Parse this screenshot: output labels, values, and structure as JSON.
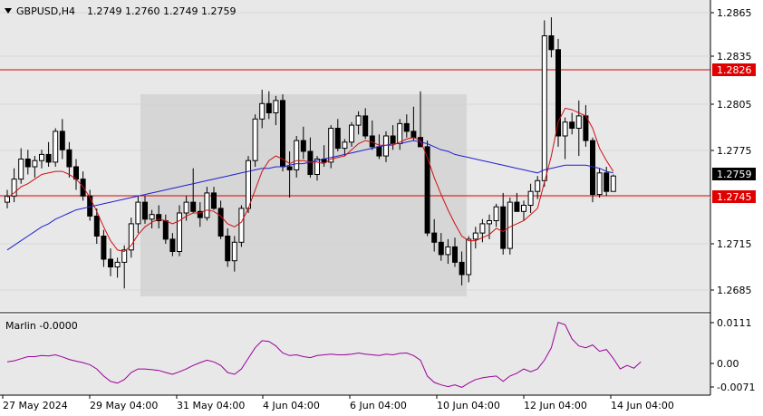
{
  "header": {
    "symbol_label": "GBPUSD,H4",
    "ohlc": "1.2749 1.2760 1.2749 1.2759"
  },
  "indicator": {
    "label": "Marlin -0.0000",
    "ticks": [
      "0.0111",
      "0.00",
      "-0.0071"
    ]
  },
  "price_axis": {
    "ticks": [
      "1.2865",
      "1.2835",
      "1.2805",
      "1.2775",
      "1.2745",
      "1.2715",
      "1.2685"
    ]
  },
  "price_tags": {
    "level_high": "1.2826",
    "current": "1.2759",
    "level_low": "1.2745"
  },
  "time_axis": [
    "27 May 2024",
    "29 May 04:00",
    "31 May 04:00",
    "4 Jun 04:00",
    "6 Jun 04:00",
    "10 Jun 04:00",
    "12 Jun 04:00",
    "14 Jun 04:00"
  ],
  "colors": {
    "background": "#e8e8e8",
    "bull": "#ffffff",
    "bear": "#000000",
    "ma_fast": "#d01010",
    "ma_slow": "#2020d0",
    "level_line": "#e00000",
    "oscillator": "#9a009a",
    "zone": "#d0d0d0"
  },
  "chart_data": {
    "type": "candlestick",
    "symbol": "GBPUSD",
    "timeframe": "H4",
    "ylim": [
      1.267,
      1.2875
    ],
    "levels": [
      1.2826,
      1.2745
    ],
    "current_price": 1.2759,
    "indicator_ylim": [
      -0.0085,
      0.0125
    ],
    "candles": [
      [
        1.2742,
        1.275,
        1.2738,
        1.2746
      ],
      [
        1.2746,
        1.2764,
        1.2742,
        1.2757
      ],
      [
        1.2757,
        1.2777,
        1.2754,
        1.277
      ],
      [
        1.277,
        1.2776,
        1.276,
        1.2765
      ],
      [
        1.2765,
        1.2772,
        1.2758,
        1.2769
      ],
      [
        1.2769,
        1.2776,
        1.2764,
        1.2773
      ],
      [
        1.2773,
        1.2781,
        1.2765,
        1.2768
      ],
      [
        1.2768,
        1.279,
        1.2765,
        1.2788
      ],
      [
        1.2788,
        1.2796,
        1.277,
        1.2776
      ],
      [
        1.2776,
        1.2781,
        1.2758,
        1.2765
      ],
      [
        1.2765,
        1.277,
        1.275,
        1.2757
      ],
      [
        1.2757,
        1.2762,
        1.2743,
        1.2746
      ],
      [
        1.2746,
        1.275,
        1.273,
        1.2733
      ],
      [
        1.2733,
        1.2738,
        1.2715,
        1.272
      ],
      [
        1.272,
        1.2724,
        1.27,
        1.2705
      ],
      [
        1.2705,
        1.2712,
        1.2694,
        1.27
      ],
      [
        1.27,
        1.2706,
        1.2693,
        1.2703
      ],
      [
        1.2703,
        1.2714,
        1.2686,
        1.2711
      ],
      [
        1.2711,
        1.2732,
        1.2706,
        1.2728
      ],
      [
        1.2728,
        1.2746,
        1.2722,
        1.2742
      ],
      [
        1.2742,
        1.2746,
        1.2728,
        1.2731
      ],
      [
        1.2731,
        1.2737,
        1.2725,
        1.2734
      ],
      [
        1.2734,
        1.274,
        1.2725,
        1.273
      ],
      [
        1.273,
        1.2734,
        1.2715,
        1.2718
      ],
      [
        1.2718,
        1.2722,
        1.2707,
        1.271
      ],
      [
        1.271,
        1.274,
        1.2707,
        1.2735
      ],
      [
        1.2735,
        1.2746,
        1.273,
        1.2742
      ],
      [
        1.2742,
        1.2764,
        1.2735,
        1.2736
      ],
      [
        1.2736,
        1.2742,
        1.2726,
        1.2732
      ],
      [
        1.2732,
        1.2752,
        1.273,
        1.2748
      ],
      [
        1.2748,
        1.2752,
        1.2737,
        1.2738
      ],
      [
        1.2738,
        1.2743,
        1.2718,
        1.272
      ],
      [
        1.272,
        1.2725,
        1.27,
        1.2704
      ],
      [
        1.2704,
        1.272,
        1.2697,
        1.2716
      ],
      [
        1.2716,
        1.274,
        1.2713,
        1.2738
      ],
      [
        1.2738,
        1.2772,
        1.2735,
        1.2769
      ],
      [
        1.2769,
        1.2799,
        1.2765,
        1.2796
      ],
      [
        1.2796,
        1.2815,
        1.279,
        1.2806
      ],
      [
        1.2806,
        1.2814,
        1.2796,
        1.28
      ],
      [
        1.28,
        1.2811,
        1.2792,
        1.2808
      ],
      [
        1.2808,
        1.2812,
        1.2762,
        1.2765
      ],
      [
        1.2765,
        1.2775,
        1.2745,
        1.2763
      ],
      [
        1.2763,
        1.2785,
        1.2758,
        1.2782
      ],
      [
        1.2782,
        1.2791,
        1.277,
        1.2775
      ],
      [
        1.2775,
        1.2784,
        1.2758,
        1.276
      ],
      [
        1.276,
        1.2772,
        1.2756,
        1.277
      ],
      [
        1.277,
        1.2779,
        1.2765,
        1.2768
      ],
      [
        1.2768,
        1.2792,
        1.2764,
        1.279
      ],
      [
        1.279,
        1.2796,
        1.2775,
        1.2777
      ],
      [
        1.2777,
        1.2783,
        1.2772,
        1.2781
      ],
      [
        1.2781,
        1.2794,
        1.2778,
        1.2792
      ],
      [
        1.2792,
        1.2801,
        1.2786,
        1.2798
      ],
      [
        1.2798,
        1.2803,
        1.2783,
        1.2785
      ],
      [
        1.2785,
        1.2795,
        1.2776,
        1.2778
      ],
      [
        1.2778,
        1.2786,
        1.277,
        1.2772
      ],
      [
        1.2772,
        1.2788,
        1.2768,
        1.2785
      ],
      [
        1.2785,
        1.2792,
        1.2776,
        1.278
      ],
      [
        1.278,
        1.2796,
        1.2776,
        1.2793
      ],
      [
        1.2793,
        1.2799,
        1.2784,
        1.2788
      ],
      [
        1.2788,
        1.2804,
        1.2782,
        1.2784
      ],
      [
        1.2784,
        1.2814,
        1.2778,
        1.2778
      ],
      [
        1.2778,
        1.2782,
        1.272,
        1.2722
      ],
      [
        1.2722,
        1.2731,
        1.271,
        1.2716
      ],
      [
        1.2716,
        1.2722,
        1.2704,
        1.2708
      ],
      [
        1.2708,
        1.2718,
        1.2702,
        1.2713
      ],
      [
        1.2713,
        1.2719,
        1.27,
        1.2703
      ],
      [
        1.2703,
        1.271,
        1.2688,
        1.2695
      ],
      [
        1.2695,
        1.272,
        1.269,
        1.2718
      ],
      [
        1.2718,
        1.2726,
        1.2712,
        1.2722
      ],
      [
        1.2722,
        1.2731,
        1.2716,
        1.2728
      ],
      [
        1.2728,
        1.2734,
        1.2718,
        1.273
      ],
      [
        1.273,
        1.2741,
        1.2726,
        1.2739
      ],
      [
        1.2739,
        1.2748,
        1.2708,
        1.2712
      ],
      [
        1.2712,
        1.2745,
        1.2708,
        1.2742
      ],
      [
        1.2742,
        1.2748,
        1.2736,
        1.2736
      ],
      [
        1.2736,
        1.2743,
        1.273,
        1.274
      ],
      [
        1.274,
        1.2754,
        1.2735,
        1.2749
      ],
      [
        1.2749,
        1.2759,
        1.2744,
        1.2756
      ],
      [
        1.2756,
        1.286,
        1.2752,
        1.285
      ],
      [
        1.285,
        1.2862,
        1.2836,
        1.2841
      ],
      [
        1.2841,
        1.2848,
        1.2778,
        1.2785
      ],
      [
        1.2785,
        1.2797,
        1.277,
        1.2794
      ],
      [
        1.2794,
        1.28,
        1.2786,
        1.279
      ],
      [
        1.279,
        1.2808,
        1.2772,
        1.2798
      ],
      [
        1.2798,
        1.2805,
        1.2778,
        1.2782
      ],
      [
        1.2782,
        1.2784,
        1.2742,
        1.2747
      ],
      [
        1.2747,
        1.2764,
        1.2745,
        1.2761
      ],
      [
        1.2761,
        1.2765,
        1.2746,
        1.2749
      ],
      [
        1.2749,
        1.276,
        1.2749,
        1.2759
      ]
    ],
    "ma_fast": [
      1.2745,
      1.2748,
      1.2752,
      1.2754,
      1.2757,
      1.276,
      1.2761,
      1.2762,
      1.2762,
      1.276,
      1.2757,
      1.2752,
      1.2745,
      1.2736,
      1.2726,
      1.2717,
      1.2711,
      1.271,
      1.2714,
      1.2721,
      1.2726,
      1.2729,
      1.2731,
      1.273,
      1.2728,
      1.273,
      1.2733,
      1.2735,
      1.2735,
      1.2737,
      1.2736,
      1.2733,
      1.2728,
      1.2726,
      1.2729,
      1.2738,
      1.275,
      1.2762,
      1.2769,
      1.2772,
      1.277,
      1.2767,
      1.2769,
      1.2769,
      1.2768,
      1.2768,
      1.2767,
      1.277,
      1.2771,
      1.2772,
      1.2776,
      1.278,
      1.2782,
      1.2781,
      1.2779,
      1.2779,
      1.2779,
      1.2781,
      1.2783,
      1.2784,
      1.2782,
      1.2771,
      1.2758,
      1.2747,
      1.2737,
      1.2728,
      1.272,
      1.2717,
      1.2717,
      1.2719,
      1.2721,
      1.2725,
      1.2723,
      1.2726,
      1.2728,
      1.273,
      1.2734,
      1.2738,
      1.2755,
      1.2772,
      1.2794,
      1.2803,
      1.2802,
      1.28,
      1.2798,
      1.279,
      1.2777,
      1.2769,
      1.2762
    ],
    "ma_slow": [
      1.2711,
      1.2714,
      1.2717,
      1.272,
      1.2723,
      1.2726,
      1.2728,
      1.2731,
      1.2733,
      1.2735,
      1.2737,
      1.2738,
      1.2739,
      1.274,
      1.2741,
      1.2742,
      1.2743,
      1.2744,
      1.2745,
      1.2746,
      1.2747,
      1.2748,
      1.2749,
      1.275,
      1.2751,
      1.2752,
      1.2753,
      1.2754,
      1.2755,
      1.2756,
      1.2757,
      1.2758,
      1.2759,
      1.276,
      1.2761,
      1.2762,
      1.2763,
      1.2764,
      1.2764,
      1.2765,
      1.2765,
      1.2766,
      1.2767,
      1.2767,
      1.2768,
      1.2769,
      1.277,
      1.2771,
      1.2772,
      1.2773,
      1.2774,
      1.2775,
      1.2776,
      1.2777,
      1.2778,
      1.2779,
      1.278,
      1.278,
      1.2781,
      1.2782,
      1.2781,
      1.278,
      1.2778,
      1.2776,
      1.2775,
      1.2773,
      1.2772,
      1.2771,
      1.277,
      1.2769,
      1.2768,
      1.2767,
      1.2766,
      1.2765,
      1.2764,
      1.2763,
      1.2762,
      1.2761,
      1.2763,
      1.2764,
      1.2765,
      1.2766,
      1.2766,
      1.2766,
      1.2766,
      1.2765,
      1.2764,
      1.2762,
      1.2761
    ],
    "marlin": [
      0.0,
      0.0003,
      0.0009,
      0.0015,
      0.0015,
      0.0018,
      0.0017,
      0.002,
      0.0014,
      0.0007,
      0.0002,
      -0.0002,
      -0.0008,
      -0.002,
      -0.004,
      -0.0055,
      -0.006,
      -0.005,
      -0.003,
      -0.002,
      -0.002,
      -0.0022,
      -0.0024,
      -0.003,
      -0.0035,
      -0.0028,
      -0.002,
      -0.001,
      -0.0002,
      0.0005,
      0.0,
      -0.001,
      -0.003,
      -0.0035,
      -0.002,
      0.001,
      0.004,
      0.006,
      0.0058,
      0.0045,
      0.0025,
      0.0018,
      0.002,
      0.0015,
      0.0012,
      0.0018,
      0.002,
      0.0022,
      0.002,
      0.002,
      0.0022,
      0.0025,
      0.0022,
      0.002,
      0.0018,
      0.0022,
      0.002,
      0.0024,
      0.0025,
      0.0018,
      0.0005,
      -0.004,
      -0.0058,
      -0.0065,
      -0.007,
      -0.0065,
      -0.0072,
      -0.006,
      -0.005,
      -0.0045,
      -0.0042,
      -0.004,
      -0.0055,
      -0.004,
      -0.0032,
      -0.002,
      -0.0028,
      -0.002,
      0.0005,
      0.004,
      0.0112,
      0.0105,
      0.0065,
      0.0045,
      0.004,
      0.0048,
      0.003,
      0.0035,
      0.001,
      -0.002,
      -0.001,
      -0.0018,
      0.0
    ]
  }
}
